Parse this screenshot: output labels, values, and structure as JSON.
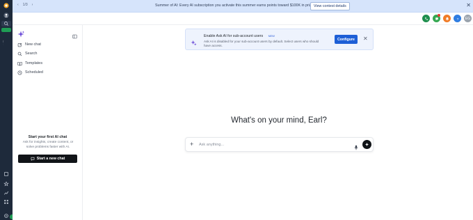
{
  "banner": {
    "counter": "1/3",
    "text": "Summer of AI: Every AI subscription you activate this summer earns points toward $100K in prizes.",
    "cta_label": "View contest details",
    "close_glyph": "✕"
  },
  "rail": {
    "icons": [
      "location-badge-icon",
      "search-icon",
      "status-indicator-icon",
      "sparkle-icon",
      "dashboard-icon",
      "contacts-icon",
      "conversations-icon",
      "calendar-icon",
      "opportunities-icon",
      "payments-icon",
      "automation-icon",
      "sites-icon",
      "memberships-icon",
      "marketing-icon",
      "reputation-icon",
      "reporting-icon",
      "app-marketplace-icon",
      "settings-icon"
    ]
  },
  "topbar": {
    "avatar_initials": "EG",
    "colors": {
      "phone": "#1f8f4e",
      "whatsapp": "#36a852",
      "notifications": "#f07c28",
      "help": "#2f7de1",
      "avatar": "#9aa3ad"
    }
  },
  "sidebar": {
    "items": [
      {
        "label": "New chat",
        "icon": "compose-icon"
      },
      {
        "label": "Search",
        "icon": "search-icon"
      },
      {
        "label": "Templates",
        "icon": "book-icon"
      },
      {
        "label": "Scheduled",
        "icon": "clock-icon"
      }
    ],
    "empty_title": "Start your first AI chat",
    "empty_subtitle": "Ask for insights, create content, or solve problems faster with AI.",
    "start_button_label": "Start a new chat"
  },
  "notice": {
    "title": "Enable Ask AI for sub-account users",
    "badge": "NEW",
    "description": "Ask AI is disabled for your sub-account users by default. Select users who should have access.",
    "configure_label": "Configure",
    "close_glyph": "✕"
  },
  "main": {
    "greeting": "What's on your mind, Earl?",
    "input_placeholder": "Ask anything...",
    "accent": "#1d5fd6"
  }
}
